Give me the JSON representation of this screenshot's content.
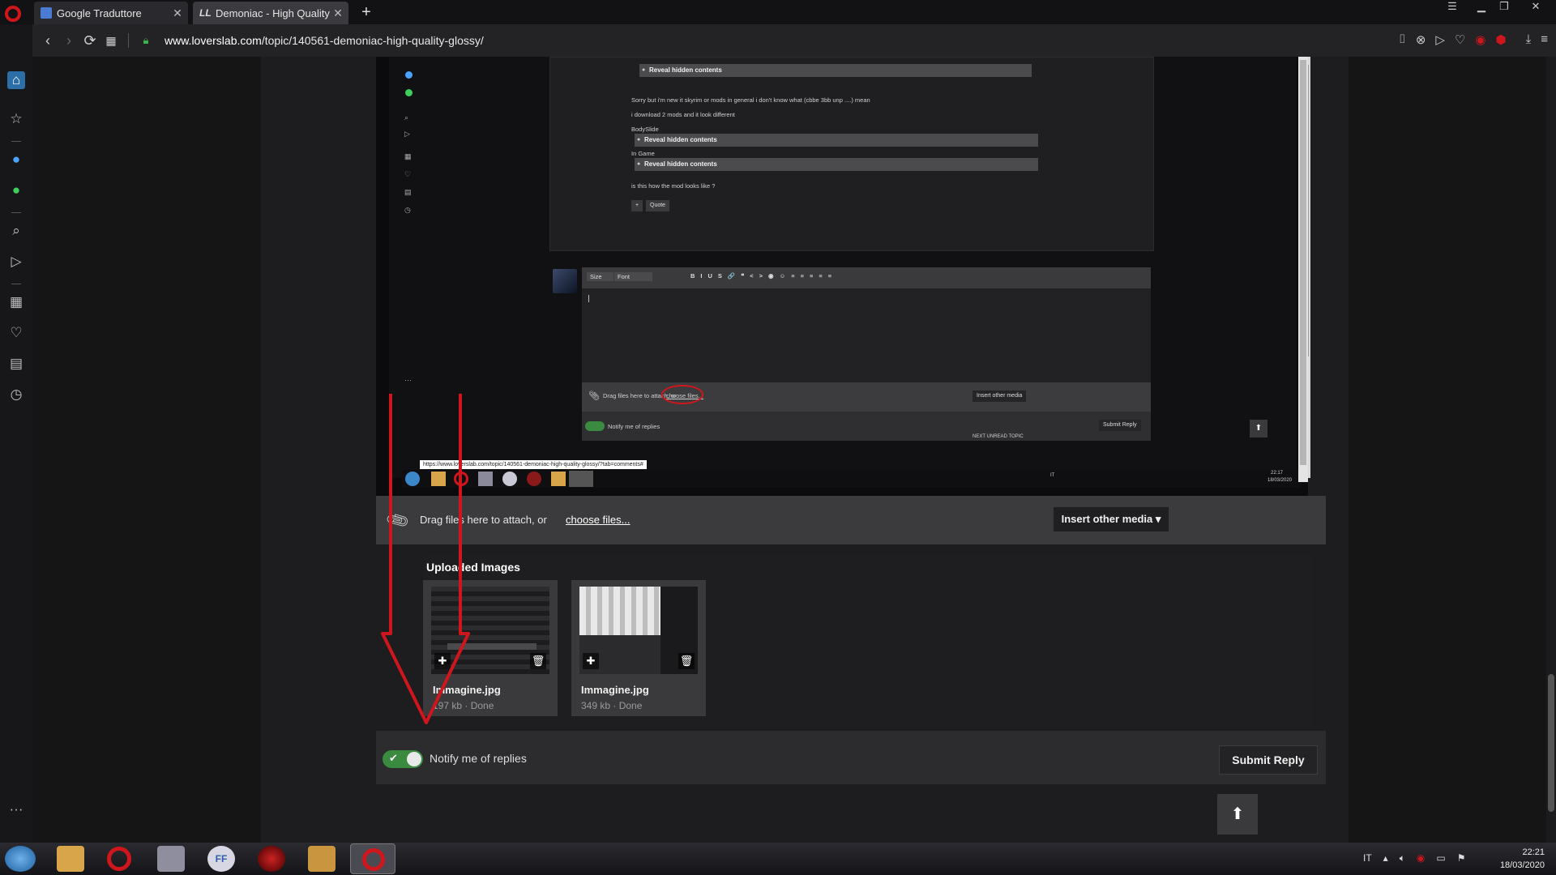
{
  "browser": {
    "tabs": [
      {
        "title": "Google Traduttore",
        "active": false
      },
      {
        "title": "Demoniac - High Quality G",
        "active": true
      }
    ],
    "new_tab_label": "+",
    "url_host": "www.loverslab.com",
    "url_path": "/topic/140561-demoniac-high-quality-glossy/"
  },
  "embedded_screenshot": {
    "reveal_label": "Reveal hidden contents",
    "post_lines": [
      "Sorry but i'm new it skyrim or mods in general i don't know what (cbbe 3bb unp ....) mean",
      "i download 2 mods and it look different",
      "BodySlide",
      "In Game",
      "is this how the mod looks like ?"
    ],
    "quote_label": "Quote",
    "toolbar_size": "Size",
    "toolbar_font": "Font",
    "attach_text": "Drag files here to attach, or",
    "attach_link": "choose files...",
    "insert_media": "Insert other media",
    "notify": "Notify me of replies",
    "submit": "Submit Reply",
    "tooltip_url": "https://www.loverslab.com/topic/140561-demoniac-high-quality-glossy/?tab=comments#",
    "next_unread": "NEXT UNREAD TOPIC",
    "clock_time": "22:17",
    "clock_date": "18/03/2020",
    "lang": "IT"
  },
  "attach": {
    "text": "Drag files here to attach, or",
    "link": "choose files...",
    "insert_media": "Insert other media ▾"
  },
  "uploaded": {
    "title": "Uploaded Images",
    "files": [
      {
        "name": "Immagine.jpg",
        "meta": "197 kb · Done"
      },
      {
        "name": "Immagine.jpg",
        "meta": "349 kb · Done"
      }
    ]
  },
  "reply": {
    "notify_label": "Notify me of replies",
    "submit_label": "Submit Reply"
  },
  "taskbar": {
    "lang": "IT",
    "time": "22:21",
    "date": "18/03/2020"
  },
  "colors": {
    "opera_red": "#d0161d",
    "annotation_red": "#d0161d",
    "toggle_green": "#3a8a3f"
  }
}
